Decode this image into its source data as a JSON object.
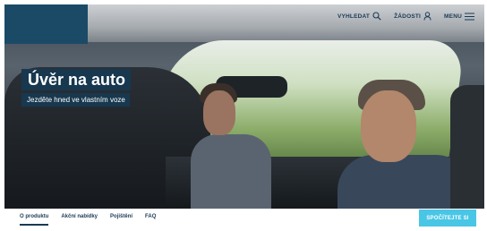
{
  "header": {
    "nav": [
      {
        "label": "VYHLEDAT",
        "icon": "search-icon"
      },
      {
        "label": "ŽÁDOSTI",
        "icon": "user-icon"
      },
      {
        "label": "MENU",
        "icon": "hamburger-icon"
      }
    ]
  },
  "hero": {
    "title": "Úvěr na auto",
    "subtitle": "Jezděte hned ve vlastním voze"
  },
  "subnav": {
    "tabs": [
      {
        "label": "O produktu",
        "active": true
      },
      {
        "label": "Akční nabídky",
        "active": false
      },
      {
        "label": "Pojištění",
        "active": false
      },
      {
        "label": "FAQ",
        "active": false
      }
    ],
    "cta_label": "SPOČÍTEJTE SI"
  },
  "colors": {
    "brand_navy": "#17384f",
    "nav_text": "#1b3a55",
    "cta": "#49c6e5"
  }
}
